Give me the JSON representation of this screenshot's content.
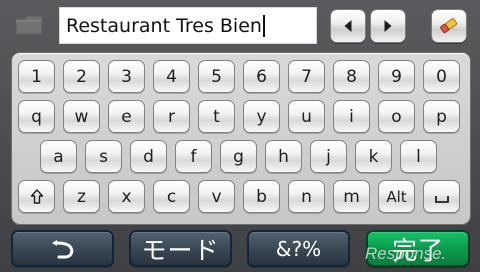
{
  "top": {
    "folder_icon": "folder-icon",
    "input_value": "Restaurant Tres Bien",
    "left_arrow_icon": "arrow-left-icon",
    "right_arrow_icon": "arrow-right-icon",
    "eraser_icon": "eraser-icon"
  },
  "keyboard": {
    "row1": [
      "1",
      "2",
      "3",
      "4",
      "5",
      "6",
      "7",
      "8",
      "9",
      "0"
    ],
    "row2": [
      "q",
      "w",
      "e",
      "r",
      "t",
      "y",
      "u",
      "i",
      "o",
      "p"
    ],
    "row3": [
      "a",
      "s",
      "d",
      "f",
      "g",
      "h",
      "j",
      "k",
      "l"
    ],
    "row4": {
      "shift_icon": "shift-icon",
      "letters": [
        "z",
        "x",
        "c",
        "v",
        "b",
        "n",
        "m"
      ],
      "alt": "Alt",
      "space_icon": "space-icon"
    }
  },
  "bottom": {
    "back_icon": "back-icon",
    "mode": "モード",
    "symbols": "&?%",
    "done": "完了"
  },
  "watermark": "Response."
}
